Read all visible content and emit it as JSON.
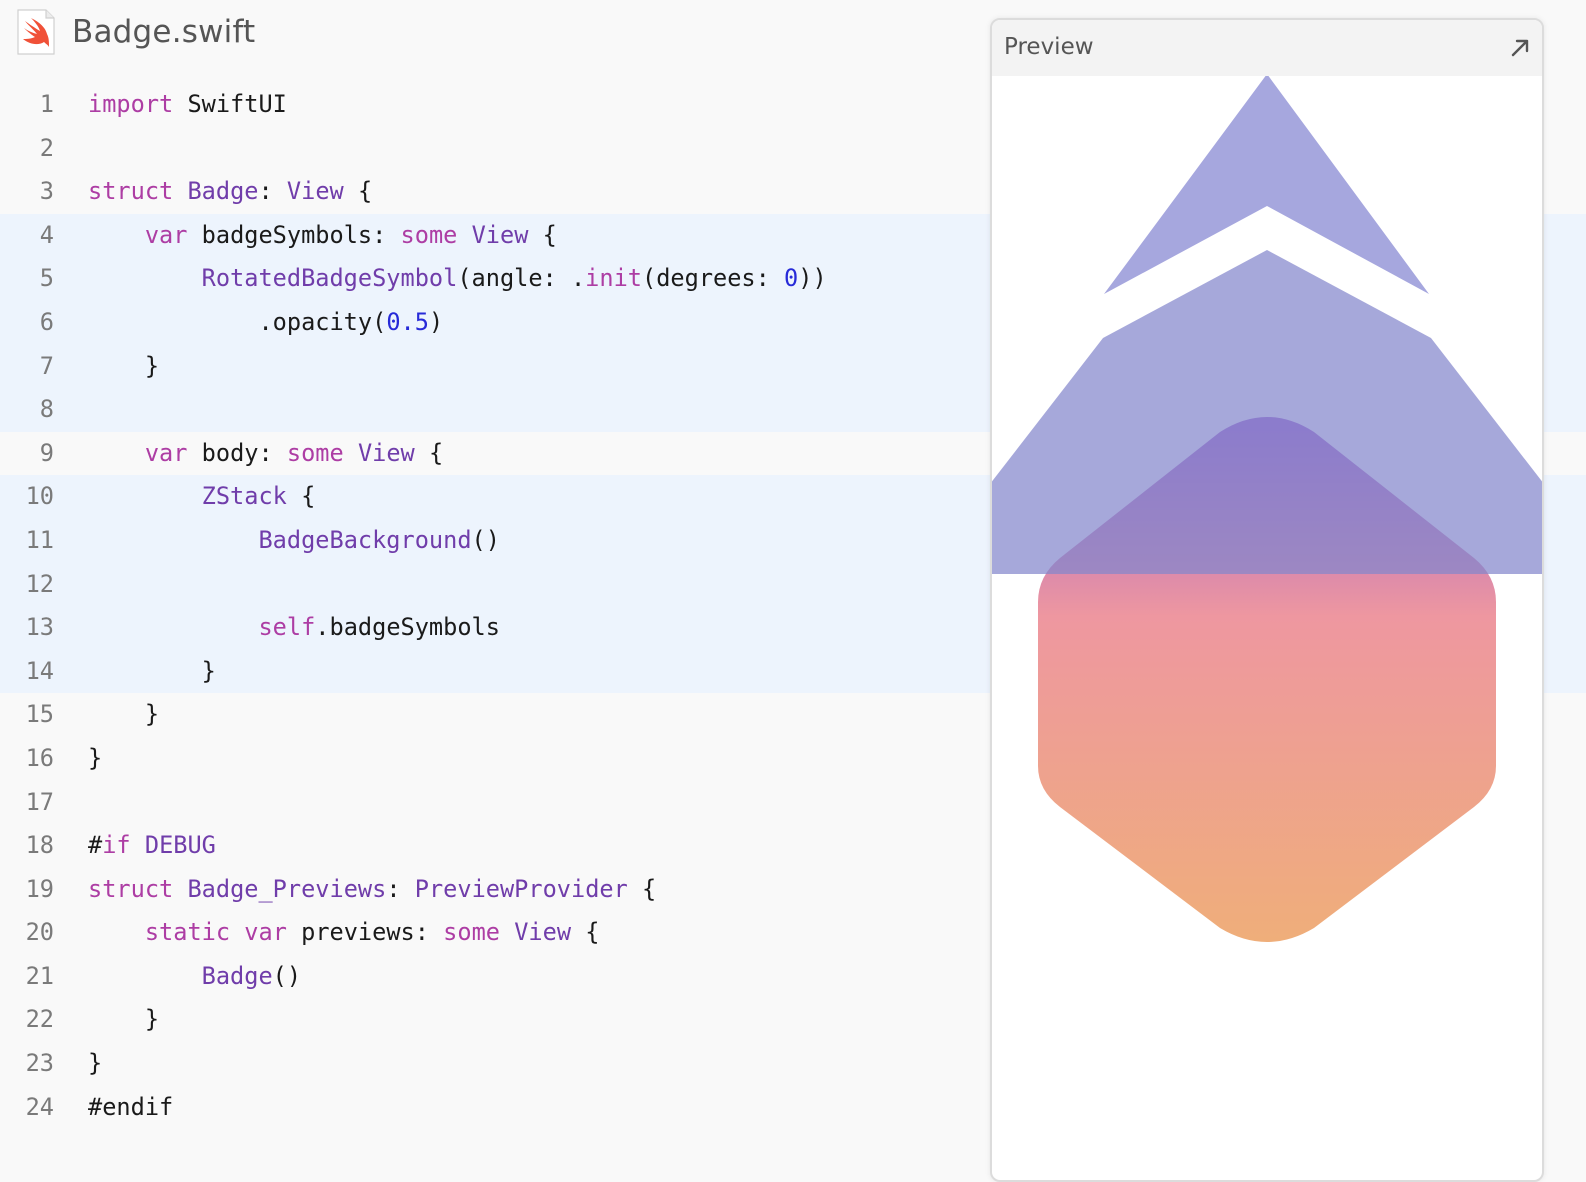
{
  "file": {
    "name": "Badge.swift",
    "icon": "swift-file-icon"
  },
  "code_lines": [
    [
      {
        "t": "import",
        "c": "kw"
      },
      {
        "t": " SwiftUI"
      }
    ],
    [],
    [
      {
        "t": "struct",
        "c": "kw"
      },
      {
        "t": " "
      },
      {
        "t": "Badge",
        "c": "ty"
      },
      {
        "t": ": "
      },
      {
        "t": "View",
        "c": "ty"
      },
      {
        "t": " {"
      }
    ],
    [
      {
        "t": "    "
      },
      {
        "t": "var",
        "c": "kw"
      },
      {
        "t": " badgeSymbols: "
      },
      {
        "t": "some",
        "c": "kw"
      },
      {
        "t": " "
      },
      {
        "t": "View",
        "c": "ty"
      },
      {
        "t": " {"
      }
    ],
    [
      {
        "t": "        "
      },
      {
        "t": "RotatedBadgeSymbol",
        "c": "ty"
      },
      {
        "t": "(angle: ."
      },
      {
        "t": "init",
        "c": "kw"
      },
      {
        "t": "(degrees: "
      },
      {
        "t": "0",
        "c": "nu"
      },
      {
        "t": "))"
      }
    ],
    [
      {
        "t": "            .opacity("
      },
      {
        "t": "0.5",
        "c": "nu"
      },
      {
        "t": ")"
      }
    ],
    [
      {
        "t": "    }"
      }
    ],
    [],
    [
      {
        "t": "    "
      },
      {
        "t": "var",
        "c": "kw"
      },
      {
        "t": " body: "
      },
      {
        "t": "some",
        "c": "kw"
      },
      {
        "t": " "
      },
      {
        "t": "View",
        "c": "ty"
      },
      {
        "t": " {"
      }
    ],
    [
      {
        "t": "        "
      },
      {
        "t": "ZStack",
        "c": "ty"
      },
      {
        "t": " {"
      }
    ],
    [
      {
        "t": "            "
      },
      {
        "t": "BadgeBackground",
        "c": "ty"
      },
      {
        "t": "()"
      }
    ],
    [],
    [
      {
        "t": "            "
      },
      {
        "t": "self",
        "c": "kw"
      },
      {
        "t": ".badgeSymbols"
      }
    ],
    [
      {
        "t": "        }"
      }
    ],
    [
      {
        "t": "    }"
      }
    ],
    [
      {
        "t": "}"
      }
    ],
    [],
    [
      {
        "t": "#"
      },
      {
        "t": "if",
        "c": "kw"
      },
      {
        "t": " "
      },
      {
        "t": "DEBUG",
        "c": "ty"
      }
    ],
    [
      {
        "t": "struct",
        "c": "kw"
      },
      {
        "t": " "
      },
      {
        "t": "Badge_Previews",
        "c": "ty"
      },
      {
        "t": ": "
      },
      {
        "t": "PreviewProvider",
        "c": "ty"
      },
      {
        "t": " {"
      }
    ],
    [
      {
        "t": "    "
      },
      {
        "t": "static",
        "c": "kw"
      },
      {
        "t": " "
      },
      {
        "t": "var",
        "c": "kw"
      },
      {
        "t": " previews: "
      },
      {
        "t": "some",
        "c": "kw"
      },
      {
        "t": " "
      },
      {
        "t": "View",
        "c": "ty"
      },
      {
        "t": " {"
      }
    ],
    [
      {
        "t": "        "
      },
      {
        "t": "Badge",
        "c": "ty"
      },
      {
        "t": "()"
      }
    ],
    [
      {
        "t": "    }"
      }
    ],
    [
      {
        "t": "}"
      }
    ],
    [
      {
        "t": "#endif"
      }
    ]
  ],
  "highlighted_lines": [
    4,
    5,
    6,
    7,
    8,
    10,
    11,
    12,
    13,
    14
  ],
  "preview": {
    "title": "Preview",
    "expand_icon": "expand-arrow-icon"
  },
  "colors": {
    "keyword": "#ad3da4",
    "type": "#703daa",
    "number": "#272ad8",
    "highlight_bg": "#edf4fd",
    "symbol_fill": "#a6a7de",
    "gradient_top": "#9e5fce",
    "gradient_mid": "#ee97a0",
    "gradient_bottom": "#efae7a"
  }
}
